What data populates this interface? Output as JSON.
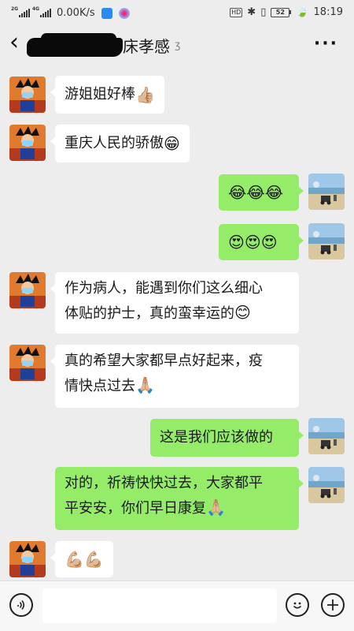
{
  "status_bar": {
    "network_left": "2G",
    "network_right": "4G",
    "speed": "0.00K/s",
    "hd_label": "HD",
    "battery": "52",
    "time": "18:19"
  },
  "header": {
    "title": "床孝感",
    "back_icon": "chevron-left-icon",
    "more_label": "···"
  },
  "messages": [
    {
      "side": "in",
      "text": "游姐姐好棒",
      "emoji": "👍🏼"
    },
    {
      "side": "in",
      "text": "重庆人民的骄傲",
      "emoji": "😁"
    },
    {
      "side": "out",
      "text": "",
      "emoji": "😂😂😂"
    },
    {
      "side": "out",
      "text": "",
      "emoji": "😍😍😍"
    },
    {
      "side": "in",
      "line1": "作为病人，能遇到你们这么细心",
      "line2": "体贴的护士，真的蛮幸运的",
      "emoji": "😊"
    },
    {
      "side": "in",
      "line1": "真的希望大家都早点好起来，疫",
      "line2": "情快点过去",
      "emoji": "🙏🏼"
    },
    {
      "side": "out",
      "text": "这是我们应该做的",
      "emoji": ""
    },
    {
      "side": "out",
      "line1": "对的，祈祷快快过去，大家都平",
      "line2": "平安安，你们早日康复",
      "emoji": "🙏🏼"
    },
    {
      "side": "in",
      "text": "",
      "emoji": "💪🏼💪🏼"
    }
  ],
  "input_bar": {
    "voice_icon": "voice-icon",
    "placeholder": "",
    "emoji_icon": "emoji-icon",
    "plus_icon": "plus-icon"
  },
  "colors": {
    "background": "#ededed",
    "outgoing_bubble": "#95ec69",
    "incoming_bubble": "#ffffff"
  }
}
